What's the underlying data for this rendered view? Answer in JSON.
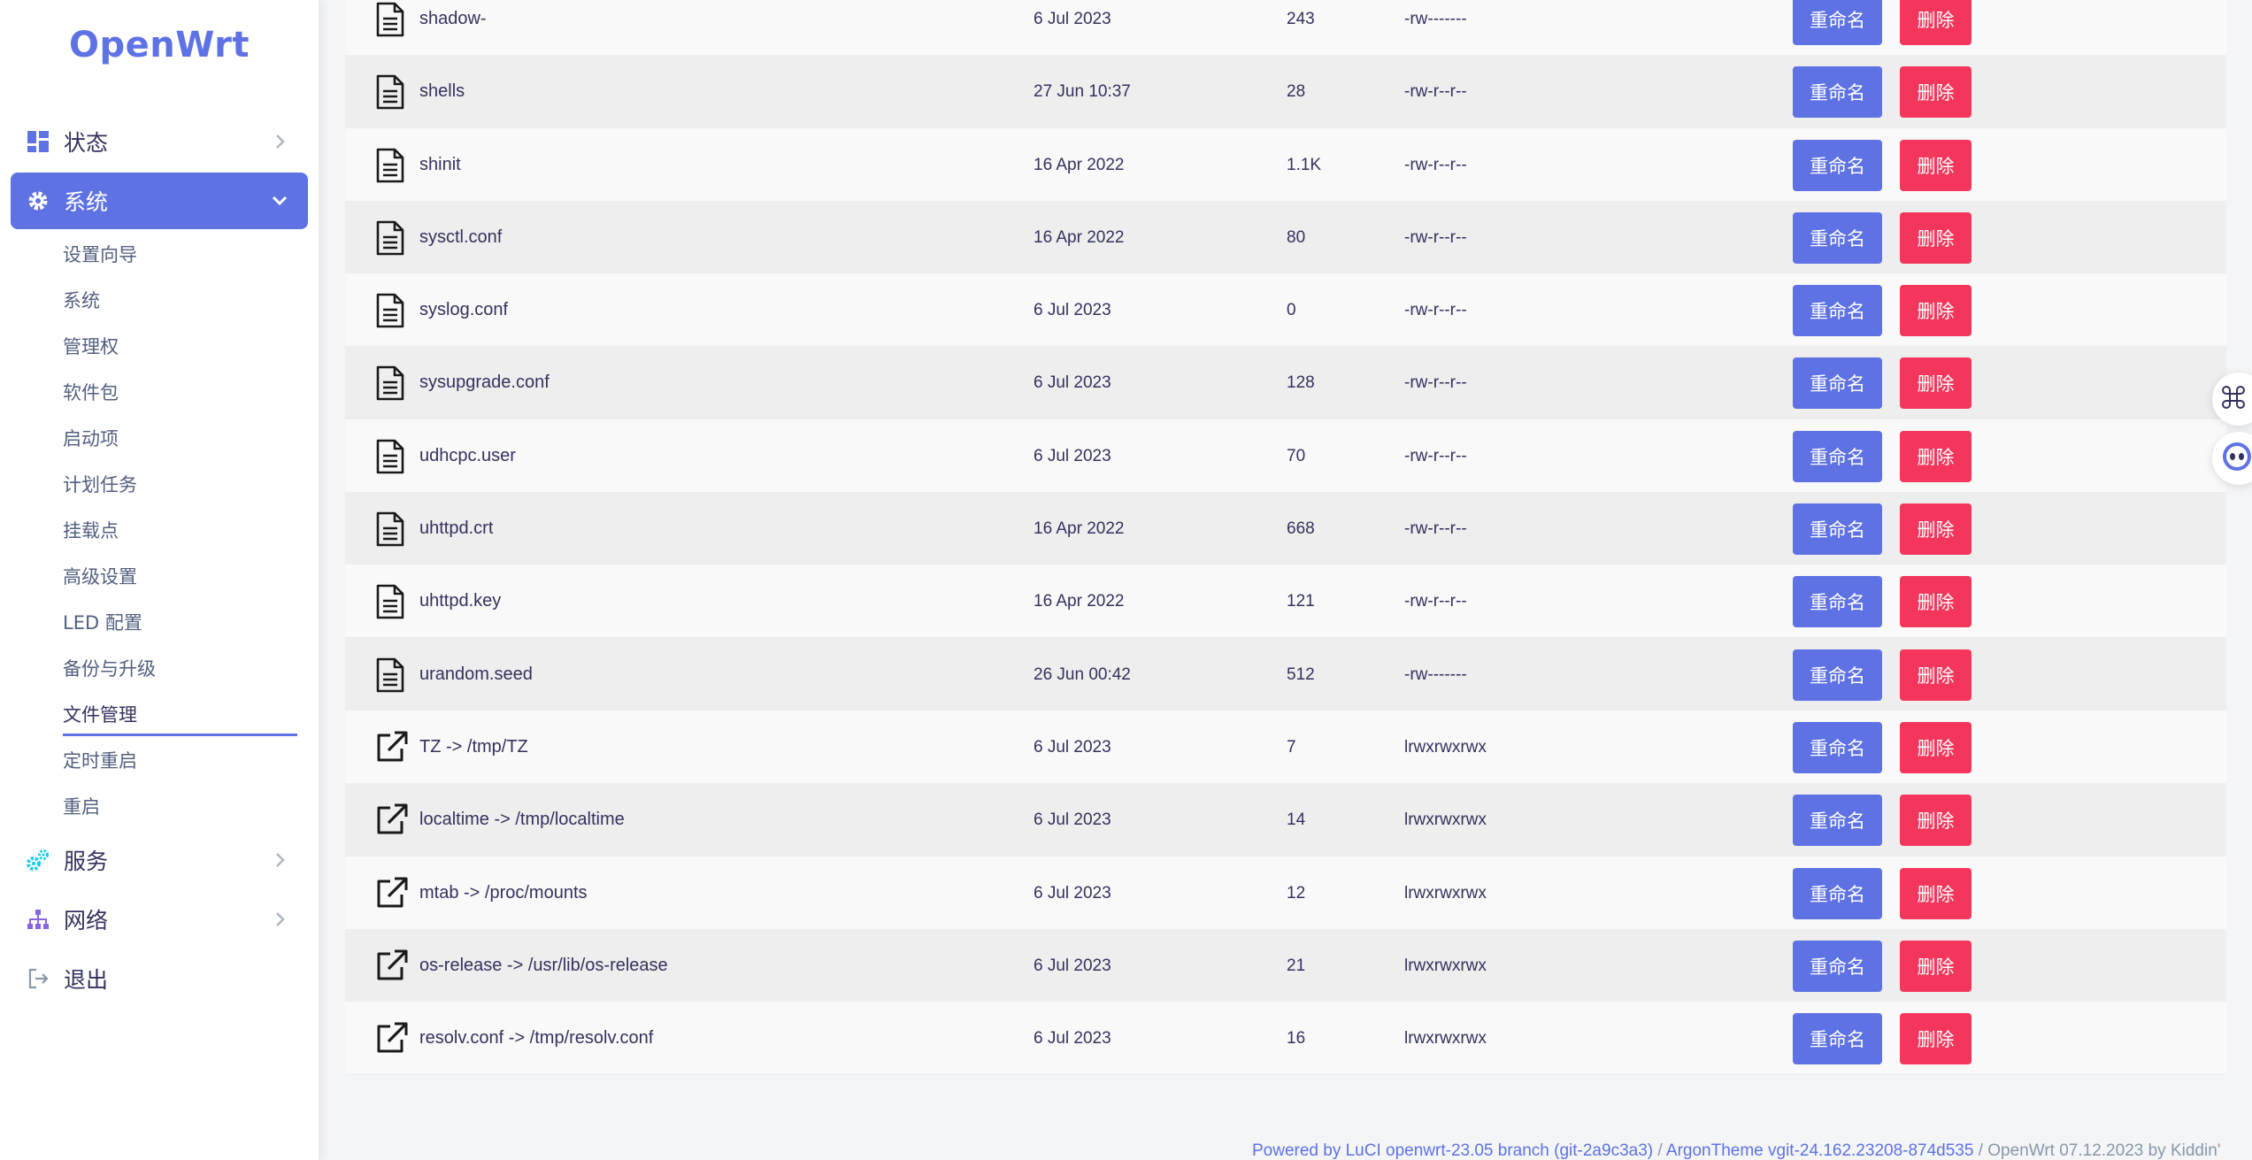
{
  "app": {
    "logo": "OpenWrt"
  },
  "colors": {
    "accent": "#5e72e4",
    "danger": "#f5365c",
    "teal": "#11cdef"
  },
  "sidebar": {
    "top_items": [
      {
        "label": "状态",
        "icon": "dashboard-icon"
      },
      {
        "label": "系统",
        "icon": "gear-icon",
        "active": true
      },
      {
        "label": "服务",
        "icon": "gears-icon"
      },
      {
        "label": "网络",
        "icon": "network-icon"
      },
      {
        "label": "退出",
        "icon": "logout-icon"
      }
    ],
    "sub_items": [
      "设置向导",
      "系统",
      "管理权",
      "软件包",
      "启动项",
      "计划任务",
      "挂载点",
      "高级设置",
      "LED 配置",
      "备份与升级",
      "文件管理",
      "定时重启",
      "重启"
    ],
    "active_sub": "文件管理"
  },
  "table": {
    "rename_label": "重命名",
    "delete_label": "删除",
    "rows": [
      {
        "name": "shadow-",
        "date": "6 Jul 2023",
        "size": "243",
        "perm": "-rw-------",
        "type": "file-icon"
      },
      {
        "name": "shells",
        "date": "27 Jun 10:37",
        "size": "28",
        "perm": "-rw-r--r--",
        "type": "file-icon"
      },
      {
        "name": "shinit",
        "date": "16 Apr 2022",
        "size": "1.1K",
        "perm": "-rw-r--r--",
        "type": "file-icon"
      },
      {
        "name": "sysctl.conf",
        "date": "16 Apr 2022",
        "size": "80",
        "perm": "-rw-r--r--",
        "type": "file-icon"
      },
      {
        "name": "syslog.conf",
        "date": "6 Jul 2023",
        "size": "0",
        "perm": "-rw-r--r--",
        "type": "file-icon"
      },
      {
        "name": "sysupgrade.conf",
        "date": "6 Jul 2023",
        "size": "128",
        "perm": "-rw-r--r--",
        "type": "file-icon"
      },
      {
        "name": "udhcpc.user",
        "date": "6 Jul 2023",
        "size": "70",
        "perm": "-rw-r--r--",
        "type": "file-icon"
      },
      {
        "name": "uhttpd.crt",
        "date": "16 Apr 2022",
        "size": "668",
        "perm": "-rw-r--r--",
        "type": "file-icon"
      },
      {
        "name": "uhttpd.key",
        "date": "16 Apr 2022",
        "size": "121",
        "perm": "-rw-r--r--",
        "type": "file-icon"
      },
      {
        "name": "urandom.seed",
        "date": "26 Jun 00:42",
        "size": "512",
        "perm": "-rw-------",
        "type": "file-icon"
      },
      {
        "name": "TZ -> /tmp/TZ",
        "date": "6 Jul 2023",
        "size": "7",
        "perm": "lrwxrwxrwx",
        "type": "link-icon"
      },
      {
        "name": "localtime -> /tmp/localtime",
        "date": "6 Jul 2023",
        "size": "14",
        "perm": "lrwxrwxrwx",
        "type": "link-icon"
      },
      {
        "name": "mtab -> /proc/mounts",
        "date": "6 Jul 2023",
        "size": "12",
        "perm": "lrwxrwxrwx",
        "type": "link-icon"
      },
      {
        "name": "os-release -> /usr/lib/os-release",
        "date": "6 Jul 2023",
        "size": "21",
        "perm": "lrwxrwxrwx",
        "type": "link-icon"
      },
      {
        "name": "resolv.conf -> /tmp/resolv.conf",
        "date": "6 Jul 2023",
        "size": "16",
        "perm": "lrwxrwxrwx",
        "type": "link-icon"
      }
    ]
  },
  "footer": {
    "luci_link": "Powered by LuCI openwrt-23.05 branch (git-2a9c3a3)",
    "sep1": " / ",
    "theme_link": "ArgonTheme vgit-24.162.23208-874d535",
    "sep2": " / ",
    "build": "OpenWrt 07.12.2023 by Kiddin'"
  }
}
